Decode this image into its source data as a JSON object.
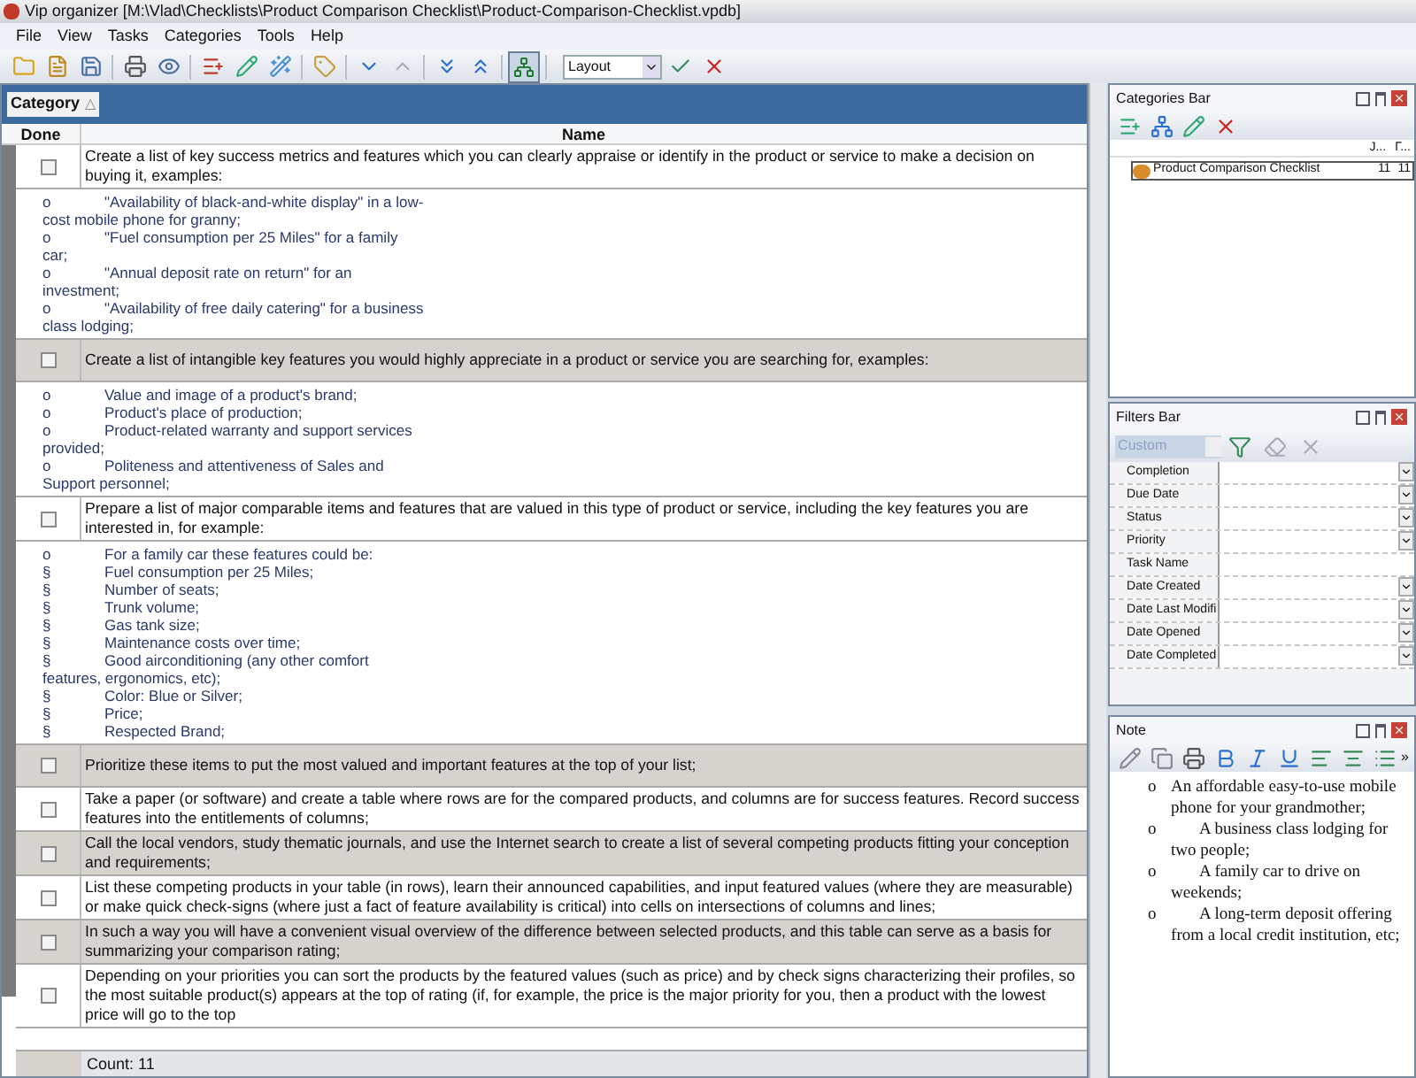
{
  "window": {
    "title": "Vip organizer [M:\\Vlad\\Checklists\\Product Comparison Checklist\\Product-Comparison-Checklist.vpdb]"
  },
  "menu": [
    "File",
    "View",
    "Tasks",
    "Categories",
    "Tools",
    "Help"
  ],
  "toolbar": {
    "layout": "Layout"
  },
  "group_by": {
    "label": "Category",
    "sort_glyph": "△"
  },
  "table": {
    "columns": [
      "Done",
      "Name"
    ],
    "rows": [
      {
        "done": false,
        "name": "Create a list of key success metrics and features which you can clearly appraise or identify in the product or service to make a decision on buying it, examples:",
        "note": [
          {
            "marker": "o",
            "text": "\"Availability of black-and-white display\" in a low-cost mobile phone for granny;"
          },
          {
            "marker": "o",
            "text": "\"Fuel consumption per 25 Miles\" for a family car;"
          },
          {
            "marker": "o",
            "text": "\"Annual deposit rate on return\" for an investment;"
          },
          {
            "marker": "o",
            "text": "\"Availability of free daily catering\" for a business class lodging;"
          }
        ]
      },
      {
        "done": false,
        "name": "Create a list of intangible key features you would highly appreciate in a product or service you are searching for, examples:",
        "note": [
          {
            "marker": "o",
            "text": "Value and image of a product's brand;"
          },
          {
            "marker": "o",
            "text": "Product's place of production;"
          },
          {
            "marker": "o",
            "text": "Product-related warranty and support services provided;"
          },
          {
            "marker": "o",
            "text": "Politeness and attentiveness of Sales and Support personnel;"
          }
        ]
      },
      {
        "done": false,
        "name": "Prepare a list of major comparable items and features that are valued in this type of product or service, including the key features you are interested in, for example:",
        "note": [
          {
            "marker": "o",
            "text": "For a family car these features could be:"
          },
          {
            "marker": "§",
            "text": "Fuel consumption per 25 Miles;"
          },
          {
            "marker": "§",
            "text": "Number of seats;"
          },
          {
            "marker": "§",
            "text": "Trunk volume;"
          },
          {
            "marker": "§",
            "text": "Gas tank size;"
          },
          {
            "marker": "§",
            "text": "Maintenance costs over time;"
          },
          {
            "marker": "§",
            "text": "Good airconditioning (any other comfort features, ergonomics, etc);"
          },
          {
            "marker": "§",
            "text": "Color: Blue or Silver;"
          },
          {
            "marker": "§",
            "text": "Price;"
          },
          {
            "marker": "§",
            "text": "Respected Brand;"
          }
        ]
      },
      {
        "done": false,
        "name": "Prioritize these items to put the most valued and important features at the top of your list;"
      },
      {
        "done": false,
        "name": "Take a paper (or software) and create a table where rows are for the compared products, and columns are for success features. Record success features into the entitlements of columns;"
      },
      {
        "done": false,
        "name": "Call the local vendors, study thematic journals, and use the Internet search to create a list of several competing products fitting your conception and requirements;"
      },
      {
        "done": false,
        "name": "List these competing products in your table (in rows), learn their announced capabilities, and input featured values (where they are measurable) or make quick check-signs (where just a fact of feature availability is critical) into cells on intersections of columns and lines;"
      },
      {
        "done": false,
        "name": "In such a way you will have a convenient visual overview of the difference between selected products, and this table can serve as a basis for summarizing your comparison rating;"
      },
      {
        "done": false,
        "name": "Depending on your priorities you can sort the products by the featured values (such as price) and by check signs characterizing their profiles, so the most suitable product(s) appears at the top of rating (if, for example, the price is the major priority for you, then a product with the lowest price will go to the top"
      }
    ],
    "footer": "Count: 11"
  },
  "categories_bar": {
    "title": "Categories Bar",
    "columns": [
      "J...",
      "Γ..."
    ],
    "items": [
      {
        "name": "Product Comparison Checklist",
        "count_1": "11",
        "count_2": "11",
        "selected": true
      }
    ]
  },
  "filters_bar": {
    "title": "Filters Bar",
    "preset": "Custom",
    "filters": [
      {
        "name": "Completion",
        "dropdown": true
      },
      {
        "name": "Due Date",
        "dropdown": true
      },
      {
        "name": "Status",
        "dropdown": true
      },
      {
        "name": "Priority",
        "dropdown": true
      },
      {
        "name": "Task Name",
        "dropdown": false
      },
      {
        "name": "Date Created",
        "dropdown": true
      },
      {
        "name": "Date Last Modifi",
        "dropdown": true
      },
      {
        "name": "Date Opened",
        "dropdown": true
      },
      {
        "name": "Date Completed",
        "dropdown": true
      }
    ]
  },
  "note_panel": {
    "title": "Note",
    "more_glyph": "»",
    "items": [
      {
        "marker": "o",
        "text": "An affordable easy-to-use mobile phone for your grandmother;",
        "indent": false
      },
      {
        "marker": "o",
        "text": "A business class lodging for two people;",
        "indent": true
      },
      {
        "marker": "o",
        "text": "A family car to drive on weekends;",
        "indent": true
      },
      {
        "marker": "o",
        "text": "A long-term deposit offering from a local credit institution, etc;",
        "indent": true
      }
    ]
  }
}
